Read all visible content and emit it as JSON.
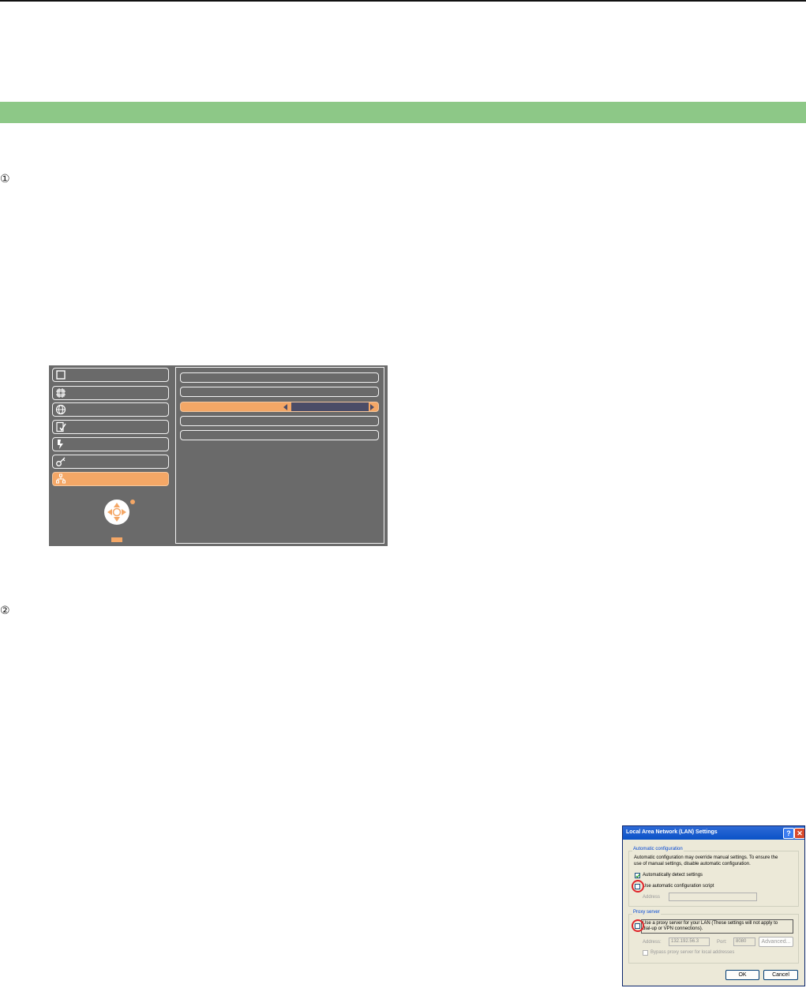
{
  "steps": [
    "①",
    "②"
  ],
  "osd_menu": {
    "left_icons": [
      "screen-icon",
      "picture-icon",
      "language-globe-icon",
      "setting-check-icon",
      "power-management-icon",
      "security-key-icon",
      "network-icon"
    ],
    "selected_left_index": 6,
    "right_rows": 5,
    "selected_right_index": 2
  },
  "lan_dialog": {
    "title": "Local Area Network (LAN) Settings",
    "help_btn": "?",
    "close_btn": "✕",
    "auto_group": "Automatic configuration",
    "auto_desc_1": "Automatic configuration may override manual settings.  To ensure the",
    "auto_desc_2": "use of manual settings, disable automatic configuration.",
    "auto_detect": "Automatically detect settings",
    "auto_script": "Use automatic configuration script",
    "address_label": "Address",
    "proxy_group": "Proxy server",
    "use_proxy_1": "Use a proxy server for your LAN (These settings will not apply to",
    "use_proxy_2": "dial-up or VPN connections).",
    "proxy_address_label": "Address:",
    "proxy_address_value": "132.192.56.3",
    "port_label": "Port:",
    "port_value": "8080",
    "advanced_btn": "Advanced...",
    "bypass": "Bypass proxy server for local addresses",
    "ok_btn": "OK",
    "cancel_btn": "Cancel",
    "auto_detect_checked": true,
    "auto_script_checked": false,
    "use_proxy_checked": false
  }
}
